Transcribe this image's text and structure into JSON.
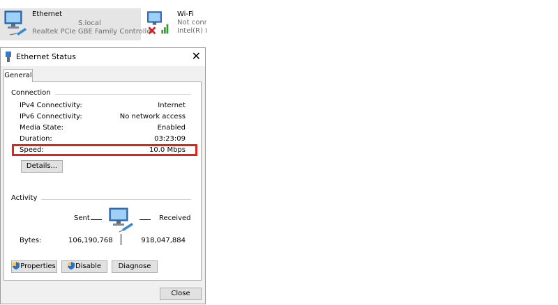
{
  "connections": {
    "ethernet": {
      "name": "Ethernet",
      "host_suffix": "S.local",
      "adapter": "Realtek PCIe GBE Family Controller"
    },
    "wifi": {
      "name": "Wi-Fi",
      "status": "Not conn",
      "adapter": "Intel(R) D"
    }
  },
  "dialog": {
    "title": "Ethernet Status",
    "tab_general": "General",
    "connection_group": "Connection",
    "rows": [
      {
        "label": "IPv4 Connectivity:",
        "value": "Internet"
      },
      {
        "label": "IPv6 Connectivity:",
        "value": "No network access"
      },
      {
        "label": "Media State:",
        "value": "Enabled"
      },
      {
        "label": "Duration:",
        "value": "03:23:09"
      },
      {
        "label": "Speed:",
        "value": "10.0 Mbps"
      }
    ],
    "details_button": "Details...",
    "activity_group": "Activity",
    "sent_label": "Sent",
    "received_label": "Received",
    "bytes_label": "Bytes:",
    "bytes_sent": "106,190,768",
    "bytes_received": "918,047,884",
    "properties_button": "Properties",
    "disable_button": "Disable",
    "diagnose_button": "Diagnose",
    "close_button": "Close"
  },
  "colors": {
    "highlight_border": "#e2231a",
    "dialog_bg": "#f0f0f0",
    "selected_connection_bg": "#e5e5e5"
  },
  "icons": [
    "network-monitor-icon",
    "wifi-signal-icon",
    "disconnected-x-icon",
    "ethernet-title-icon",
    "close-icon",
    "uac-shield-icon",
    "network-activity-icon"
  ]
}
